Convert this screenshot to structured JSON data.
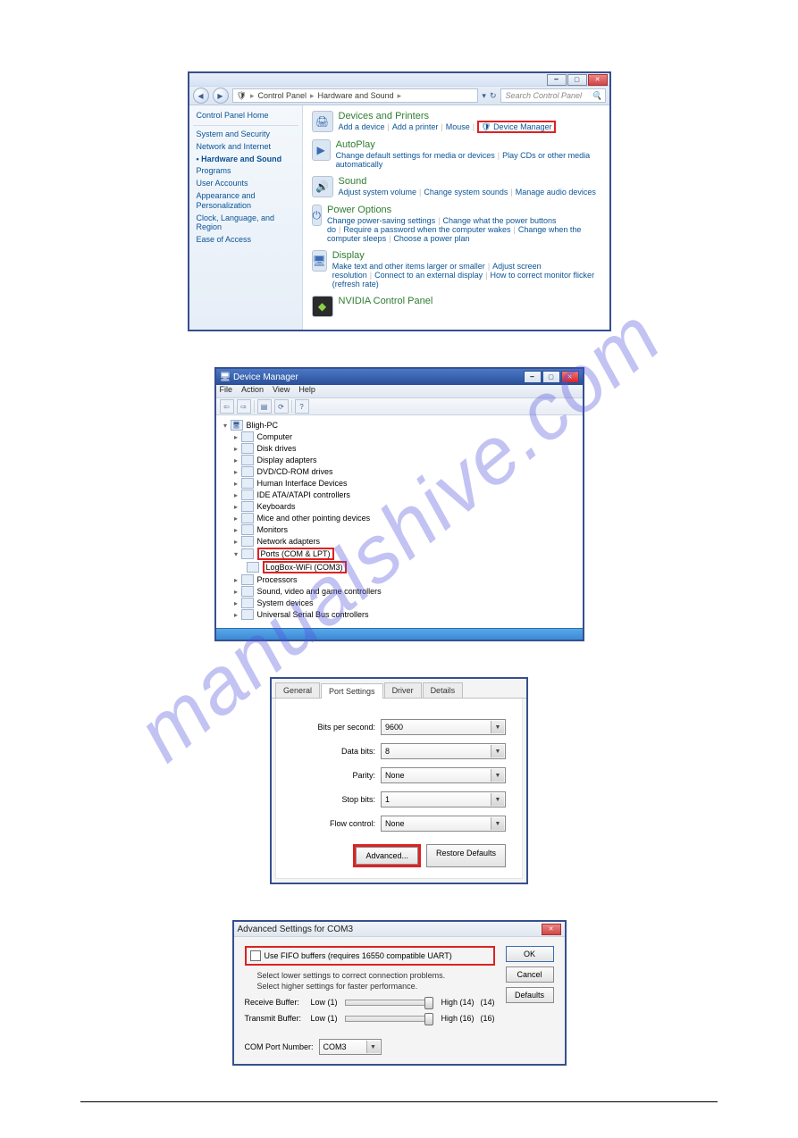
{
  "watermark": "manualshive.com",
  "cp": {
    "breadcrumb": [
      "Control Panel",
      "Hardware and Sound"
    ],
    "search_placeholder": "Search Control Panel",
    "leftnav": {
      "home": "Control Panel Home",
      "items": [
        "System and Security",
        "Network and Internet",
        "Hardware and Sound",
        "Programs",
        "User Accounts",
        "Appearance and Personalization",
        "Clock, Language, and Region",
        "Ease of Access"
      ],
      "active_index": 2
    },
    "cats": [
      {
        "icon": "🖨",
        "title": "Devices and Printers",
        "links": [
          "Add a device",
          "Add a printer",
          "Mouse"
        ],
        "extra": "Device Manager",
        "extra_highlight": true
      },
      {
        "icon": "▶",
        "title": "AutoPlay",
        "links": [
          "Change default settings for media or devices",
          "Play CDs or other media automatically"
        ]
      },
      {
        "icon": "🔊",
        "title": "Sound",
        "links": [
          "Adjust system volume",
          "Change system sounds",
          "Manage audio devices"
        ]
      },
      {
        "icon": "⏻",
        "title": "Power Options",
        "links": [
          "Change power-saving settings",
          "Change what the power buttons do",
          "Require a password when the computer wakes",
          "Change when the computer sleeps",
          "Choose a power plan"
        ]
      },
      {
        "icon": "🖥",
        "title": "Display",
        "links": [
          "Make text and other items larger or smaller",
          "Adjust screen resolution",
          "Connect to an external display",
          "How to correct monitor flicker (refresh rate)"
        ]
      },
      {
        "icon": "◆",
        "title": "NVIDIA Control Panel",
        "links": [],
        "nvidia": true
      }
    ]
  },
  "dm": {
    "title": "Device Manager",
    "menus": [
      "File",
      "Action",
      "View",
      "Help"
    ],
    "root": "Bligh-PC",
    "nodes": [
      {
        "label": "Computer"
      },
      {
        "label": "Disk drives"
      },
      {
        "label": "Display adapters"
      },
      {
        "label": "DVD/CD-ROM drives"
      },
      {
        "label": "Human Interface Devices"
      },
      {
        "label": "IDE ATA/ATAPI controllers"
      },
      {
        "label": "Keyboards"
      },
      {
        "label": "Mice and other pointing devices"
      },
      {
        "label": "Monitors"
      },
      {
        "label": "Network adapters"
      },
      {
        "label": "Ports (COM & LPT)",
        "expanded": true,
        "highlight": true,
        "children": [
          {
            "label": "LogBox-WiFi (COM3)",
            "highlight": true
          }
        ]
      },
      {
        "label": "Processors"
      },
      {
        "label": "Sound, video and game controllers"
      },
      {
        "label": "System devices"
      },
      {
        "label": "Universal Serial Bus controllers"
      }
    ]
  },
  "ps": {
    "tabs": [
      "General",
      "Port Settings",
      "Driver",
      "Details"
    ],
    "active_tab": 1,
    "fields": {
      "bps_label": "Bits per second:",
      "bps_value": "9600",
      "databits_label": "Data bits:",
      "databits_value": "8",
      "parity_label": "Parity:",
      "parity_value": "None",
      "stopbits_label": "Stop bits:",
      "stopbits_value": "1",
      "flow_label": "Flow control:",
      "flow_value": "None"
    },
    "buttons": {
      "advanced": "Advanced...",
      "restore": "Restore Defaults"
    }
  },
  "as": {
    "title": "Advanced Settings for COM3",
    "fifo_label": "Use FIFO buffers (requires 16550 compatible UART)",
    "hint1": "Select lower settings to correct connection problems.",
    "hint2": "Select higher settings for faster performance.",
    "recv_label": "Receive Buffer:",
    "recv_low": "Low (1)",
    "recv_high": "High (14)",
    "recv_val": "(14)",
    "tx_label": "Transmit Buffer:",
    "tx_low": "Low (1)",
    "tx_high": "High (16)",
    "tx_val": "(16)",
    "com_label": "COM Port Number:",
    "com_value": "COM3",
    "buttons": {
      "ok": "OK",
      "cancel": "Cancel",
      "defaults": "Defaults"
    }
  }
}
